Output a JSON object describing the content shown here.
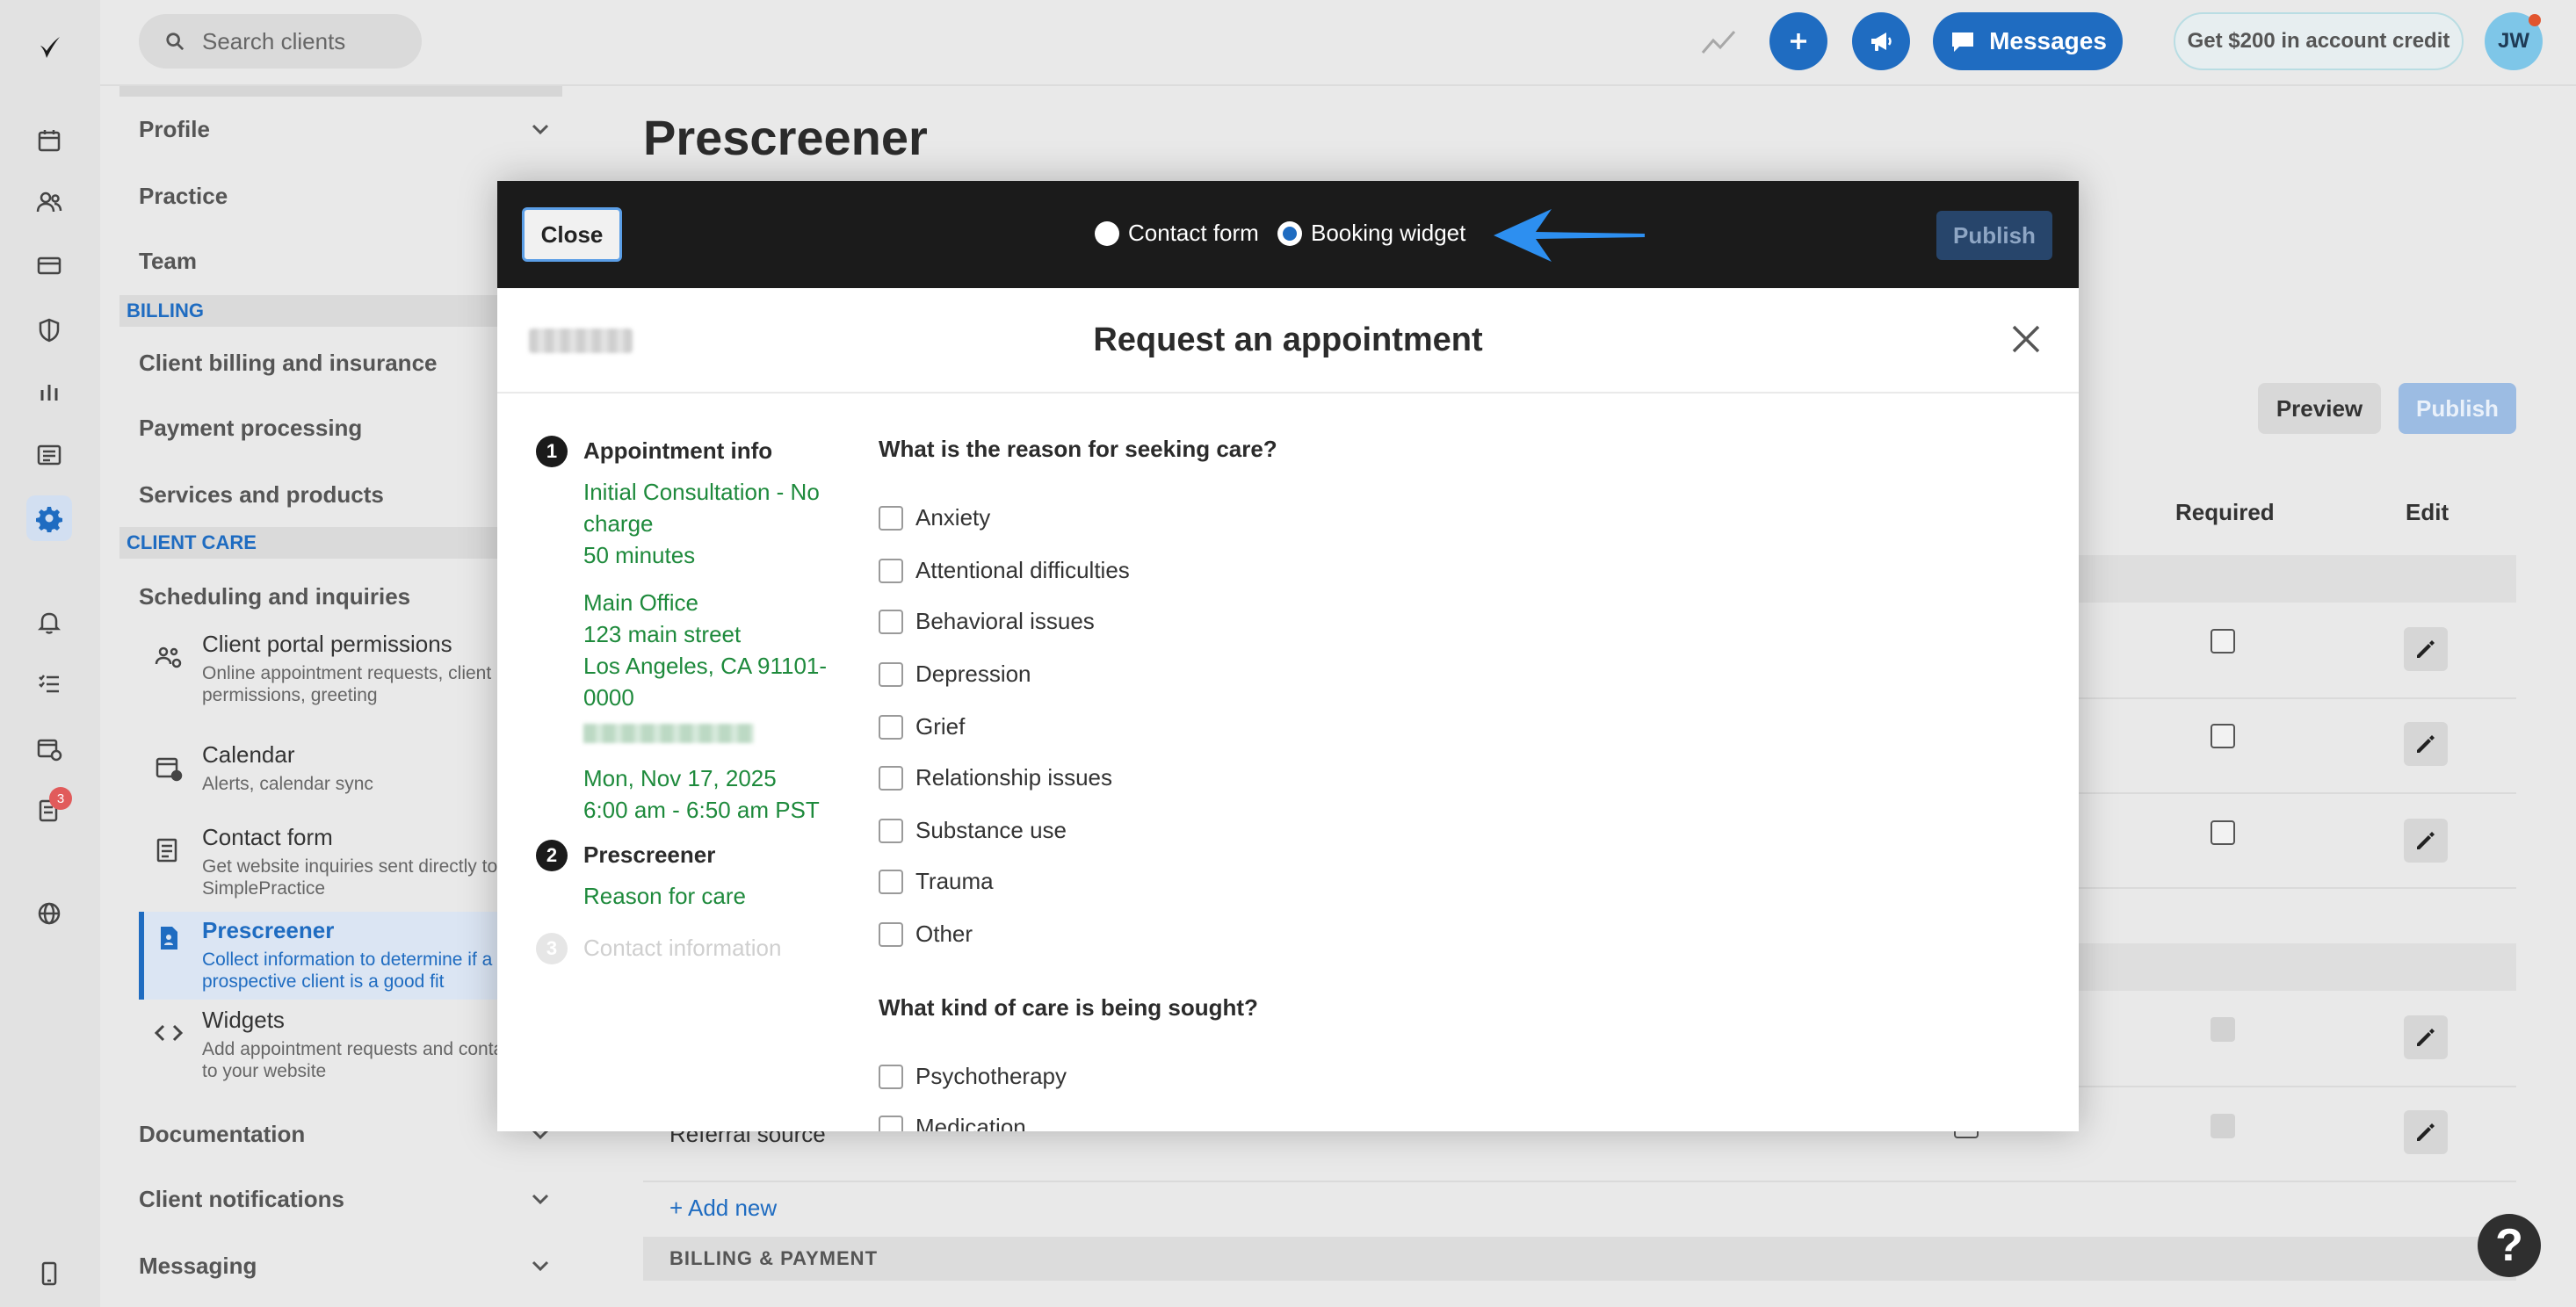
{
  "topbar": {
    "search_placeholder": "Search clients",
    "messages_label": "Messages",
    "credit_label": "Get $200 in account credit",
    "avatar_initials": "JW"
  },
  "rail": {
    "notification_badge": "3"
  },
  "nav": {
    "profile": "Profile",
    "practice": "Practice",
    "team": "Team",
    "billing_section": "BILLING",
    "client_billing": "Client billing and insurance",
    "payment_processing": "Payment processing",
    "services_products": "Services and products",
    "client_care_section": "CLIENT CARE",
    "scheduling": "Scheduling and inquiries",
    "subitems": [
      {
        "title": "Client portal permissions",
        "desc": "Online appointment requests, client permissions, greeting"
      },
      {
        "title": "Calendar",
        "desc": "Alerts, calendar sync"
      },
      {
        "title": "Contact form",
        "desc": "Get website inquiries sent directly to SimplePractice"
      },
      {
        "title": "Prescreener",
        "desc": "Collect information to determine if a prospective client is a good fit"
      },
      {
        "title": "Widgets",
        "desc": "Add appointment requests and contact forms to your website"
      }
    ],
    "documentation": "Documentation",
    "client_notifications": "Client notifications",
    "messaging": "Messaging"
  },
  "page": {
    "title": "Prescreener",
    "preview_label": "Preview",
    "publish_label": "Publish",
    "col_required": "Required",
    "col_edit": "Edit",
    "referral_source": "Referral source",
    "add_new": "+ Add new",
    "billing_payment": "BILLING & PAYMENT",
    "help": "?"
  },
  "modal": {
    "close_label": "Close",
    "radio_contact": "Contact form",
    "radio_booking": "Booking widget",
    "selected_mode": "Booking widget",
    "publish_label": "Publish",
    "title": "Request an appointment",
    "steps": {
      "step1_num": "1",
      "step1_title": "Appointment info",
      "service": "Initial Consultation - No charge",
      "duration": "50 minutes",
      "office": "Main Office",
      "street": "123 main street",
      "city": "Los Angeles, CA 91101-0000",
      "date": "Mon, Nov 17, 2025",
      "time": "6:00 am - 6:50 am PST",
      "step2_num": "2",
      "step2_title": "Prescreener",
      "step2_info": "Reason for care",
      "step3_num": "3",
      "step3_title": "Contact information"
    },
    "q1": "What is the reason for seeking care?",
    "q1_options": [
      "Anxiety",
      "Attentional difficulties",
      "Behavioral issues",
      "Depression",
      "Grief",
      "Relationship issues",
      "Substance use",
      "Trauma",
      "Other"
    ],
    "q2": "What kind of care is being sought?",
    "q2_options": [
      "Psychotherapy",
      "Medication"
    ]
  }
}
